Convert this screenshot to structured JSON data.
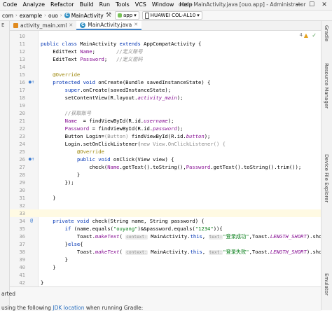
{
  "menubar": {
    "items": [
      "Code",
      "Analyze",
      "Refactor",
      "Build",
      "Run",
      "Tools",
      "VCS",
      "Window",
      "Help"
    ],
    "title": "ouo - MainActivity.java [ouo.app] - Administrator",
    "controls": [
      "—",
      "☐",
      "✕"
    ]
  },
  "navbar": {
    "crumbs": [
      "com",
      "example",
      "ouo"
    ],
    "file": "MainActivity",
    "config": "app",
    "device": "HUAWEI COL-AL10"
  },
  "left_strip": {
    "label": "E"
  },
  "tabs": [
    {
      "label": "activity_main.xml",
      "icon": "xml-file-icon"
    },
    {
      "label": "MainActivity.java",
      "icon": "java-class-icon"
    }
  ],
  "editor": {
    "warning_count": "4",
    "lines": [
      {
        "n": "10",
        "tokens": []
      },
      {
        "n": "11",
        "tokens": [
          {
            "t": "public class ",
            "c": "kw"
          },
          {
            "t": "MainActivity ",
            "c": ""
          },
          {
            "t": "extends ",
            "c": "kw"
          },
          {
            "t": "AppCompatActivity {",
            "c": ""
          }
        ]
      },
      {
        "n": "12",
        "tokens": [
          {
            "t": "    EditText ",
            "c": ""
          },
          {
            "t": "Name",
            "c": "fld"
          },
          {
            "t": ";       ",
            "c": ""
          },
          {
            "t": "//定义账号",
            "c": "cm"
          }
        ]
      },
      {
        "n": "13",
        "tokens": [
          {
            "t": "    EditText ",
            "c": ""
          },
          {
            "t": "Password",
            "c": "fld"
          },
          {
            "t": ";   ",
            "c": ""
          },
          {
            "t": "//定义密码",
            "c": "cm"
          }
        ]
      },
      {
        "n": "14",
        "tokens": []
      },
      {
        "n": "15",
        "tokens": [
          {
            "t": "    @Override",
            "c": "ann"
          }
        ]
      },
      {
        "n": "16",
        "marker": "●↑",
        "tokens": [
          {
            "t": "    protected void ",
            "c": "kw"
          },
          {
            "t": "onCreate(Bundle savedInstanceState) {",
            "c": ""
          }
        ]
      },
      {
        "n": "17",
        "tokens": [
          {
            "t": "        ",
            "c": ""
          },
          {
            "t": "super",
            "c": "kw"
          },
          {
            "t": ".onCreate(savedInstanceState);",
            "c": ""
          }
        ]
      },
      {
        "n": "18",
        "tokens": [
          {
            "t": "        setContentView(R.layout.",
            "c": ""
          },
          {
            "t": "activity_main",
            "c": "it"
          },
          {
            "t": ");",
            "c": ""
          }
        ]
      },
      {
        "n": "19",
        "tokens": []
      },
      {
        "n": "20",
        "tokens": [
          {
            "t": "        ",
            "c": ""
          },
          {
            "t": "//获取账号",
            "c": "cm"
          }
        ]
      },
      {
        "n": "21",
        "tokens": [
          {
            "t": "        ",
            "c": ""
          },
          {
            "t": "Name",
            "c": "fld"
          },
          {
            "t": "  = findViewById(R.id.",
            "c": ""
          },
          {
            "t": "username",
            "c": "it"
          },
          {
            "t": ");",
            "c": ""
          }
        ]
      },
      {
        "n": "22",
        "tokens": [
          {
            "t": "        ",
            "c": ""
          },
          {
            "t": "Password",
            "c": "fld"
          },
          {
            "t": " = findViewById(R.id.",
            "c": ""
          },
          {
            "t": "password",
            "c": "it"
          },
          {
            "t": ");",
            "c": ""
          }
        ]
      },
      {
        "n": "23",
        "tokens": [
          {
            "t": "        Button Login=",
            "c": ""
          },
          {
            "t": "(Button)",
            "c": "gray"
          },
          {
            "t": " findViewById(R.id.",
            "c": ""
          },
          {
            "t": "button",
            "c": "it"
          },
          {
            "t": ");",
            "c": ""
          }
        ]
      },
      {
        "n": "24",
        "tokens": [
          {
            "t": "        Login.setOnClickListener(",
            "c": ""
          },
          {
            "t": "new View.OnClickListener() {",
            "c": "gray"
          }
        ]
      },
      {
        "n": "25",
        "tokens": [
          {
            "t": "            @Override",
            "c": "ann"
          }
        ]
      },
      {
        "n": "26",
        "marker": "●↑",
        "tokens": [
          {
            "t": "            ",
            "c": ""
          },
          {
            "t": "public void ",
            "c": "kw"
          },
          {
            "t": "onClick(View view) {",
            "c": ""
          }
        ]
      },
      {
        "n": "27",
        "tokens": [
          {
            "t": "                check(",
            "c": ""
          },
          {
            "t": "Name",
            "c": "fld"
          },
          {
            "t": ".getText().toString(),",
            "c": ""
          },
          {
            "t": "Password",
            "c": "fld"
          },
          {
            "t": ".getText().toString().trim());",
            "c": ""
          }
        ]
      },
      {
        "n": "28",
        "tokens": [
          {
            "t": "            }",
            "c": ""
          }
        ]
      },
      {
        "n": "29",
        "tokens": [
          {
            "t": "        });",
            "c": ""
          }
        ]
      },
      {
        "n": "30",
        "tokens": []
      },
      {
        "n": "31",
        "tokens": [
          {
            "t": "    }",
            "c": ""
          }
        ]
      },
      {
        "n": "32",
        "tokens": []
      },
      {
        "n": "33",
        "highlight": true,
        "tokens": []
      },
      {
        "n": "34",
        "marker": "@",
        "tokens": [
          {
            "t": "    private void ",
            "c": "kw"
          },
          {
            "t": "check(String name, String password) {",
            "c": ""
          }
        ]
      },
      {
        "n": "35",
        "tokens": [
          {
            "t": "        ",
            "c": ""
          },
          {
            "t": "if ",
            "c": "kw"
          },
          {
            "t": "(name.equals(",
            "c": ""
          },
          {
            "t": "\"ouyang\"",
            "c": "str"
          },
          {
            "t": ")&&password.equals(",
            "c": ""
          },
          {
            "t": "\"1234\"",
            "c": "str"
          },
          {
            "t": ")){",
            "c": ""
          }
        ]
      },
      {
        "n": "36",
        "tokens": [
          {
            "t": "            Toast.",
            "c": ""
          },
          {
            "t": "makeText",
            "c": "it"
          },
          {
            "t": "( ",
            "c": ""
          },
          {
            "t": "context:",
            "c": "hint"
          },
          {
            "t": " MainActivity.",
            "c": ""
          },
          {
            "t": "this",
            "c": "kw"
          },
          {
            "t": ", ",
            "c": ""
          },
          {
            "t": "text:",
            "c": "hint"
          },
          {
            "t": "\"登录成功\"",
            "c": "str"
          },
          {
            "t": ",Toast.",
            "c": ""
          },
          {
            "t": "LENGTH_SHORT",
            "c": "it"
          },
          {
            "t": ").show();",
            "c": ""
          },
          {
            "t": "//弹框",
            "c": "cm"
          }
        ]
      },
      {
        "n": "37",
        "tokens": [
          {
            "t": "        }",
            "c": ""
          },
          {
            "t": "else",
            "c": "kw"
          },
          {
            "t": "{",
            "c": ""
          }
        ]
      },
      {
        "n": "38",
        "tokens": [
          {
            "t": "            Toast.",
            "c": ""
          },
          {
            "t": "makeText",
            "c": "it"
          },
          {
            "t": "( ",
            "c": ""
          },
          {
            "t": "context:",
            "c": "hint"
          },
          {
            "t": " MainActivity.",
            "c": ""
          },
          {
            "t": "this",
            "c": "kw"
          },
          {
            "t": ", ",
            "c": ""
          },
          {
            "t": "text:",
            "c": "hint"
          },
          {
            "t": "\"登录失败\"",
            "c": "str"
          },
          {
            "t": ",Toast.",
            "c": ""
          },
          {
            "t": "LENGTH_SHORT",
            "c": "it"
          },
          {
            "t": ").show();",
            "c": ""
          },
          {
            "t": "//弹框",
            "c": "cm"
          }
        ]
      },
      {
        "n": "39",
        "tokens": [
          {
            "t": "        }",
            "c": ""
          }
        ]
      },
      {
        "n": "40",
        "tokens": [
          {
            "t": "    }",
            "c": ""
          }
        ]
      },
      {
        "n": "41",
        "tokens": []
      },
      {
        "n": "42",
        "tokens": [
          {
            "t": "}",
            "c": ""
          }
        ]
      },
      {
        "n": "43",
        "tokens": []
      }
    ]
  },
  "right_strip": {
    "labels": [
      "Gradle",
      "Resource Manager",
      "Device File Explorer",
      "Emulator"
    ]
  },
  "bottom": {
    "line1": "arted",
    "line2_prefix": "using the following ",
    "line2_link": "JDK location",
    "line2_suffix": " when running Gradle:"
  },
  "colors": {
    "accent": "#4083c9",
    "keyword": "#0033b3",
    "string": "#067d17",
    "field": "#871094"
  }
}
